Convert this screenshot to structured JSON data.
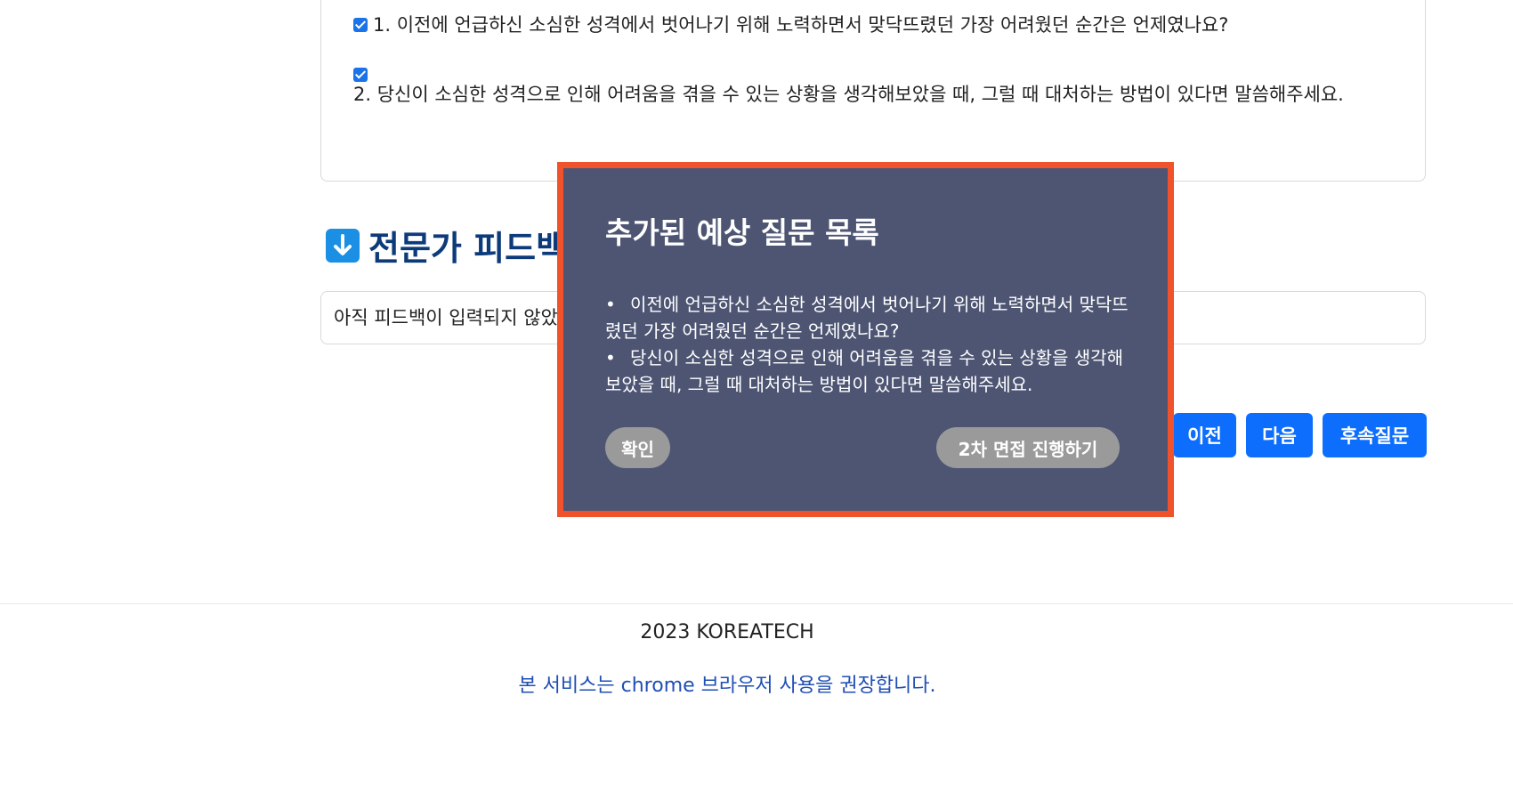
{
  "questions": [
    {
      "checked": true,
      "text": "1. 이전에 언급하신 소심한 성격에서 벗어나기 위해 노력하면서 맞닥뜨렸던 가장 어려웠던 순간은 언제였나요?"
    },
    {
      "checked": true,
      "text": "2. 당신이 소심한 성격으로 인해 어려움을 겪을 수 있는 상황을 생각해보았을 때, 그럴 때 대처하는 방법이 있다면 말씀해주세요."
    }
  ],
  "feedback": {
    "icon": "arrow-down-icon",
    "title": "전문가 피드백",
    "content": "아직 피드백이 입력되지 않았습니다."
  },
  "nav": {
    "prev_label": "이전",
    "next_label": "다음",
    "followup_label": "후속질문"
  },
  "footer": {
    "copyright": "2023 KOREATECH",
    "note": "본 서비스는 chrome 브라우저 사용을 권장합니다."
  },
  "modal": {
    "title": "추가된 예상 질문 목록",
    "items": [
      "이전에 언급하신 소심한 성격에서 벗어나기 위해 노력하면서 맞닥뜨렸던 가장 어려웠던 순간은 언제였나요?",
      "당신이 소심한 성격으로 인해 어려움을 겪을 수 있는 상황을 생각해보았을 때, 그럴 때 대처하는 방법이 있다면 말씀해주세요."
    ],
    "confirm_label": "확인",
    "second_interview_label": "2차 면접 진행하기"
  },
  "colors": {
    "primary": "#0d6efd",
    "modal_bg": "#4d5573",
    "modal_border": "#f0522c",
    "heading": "#0d3b7a"
  }
}
